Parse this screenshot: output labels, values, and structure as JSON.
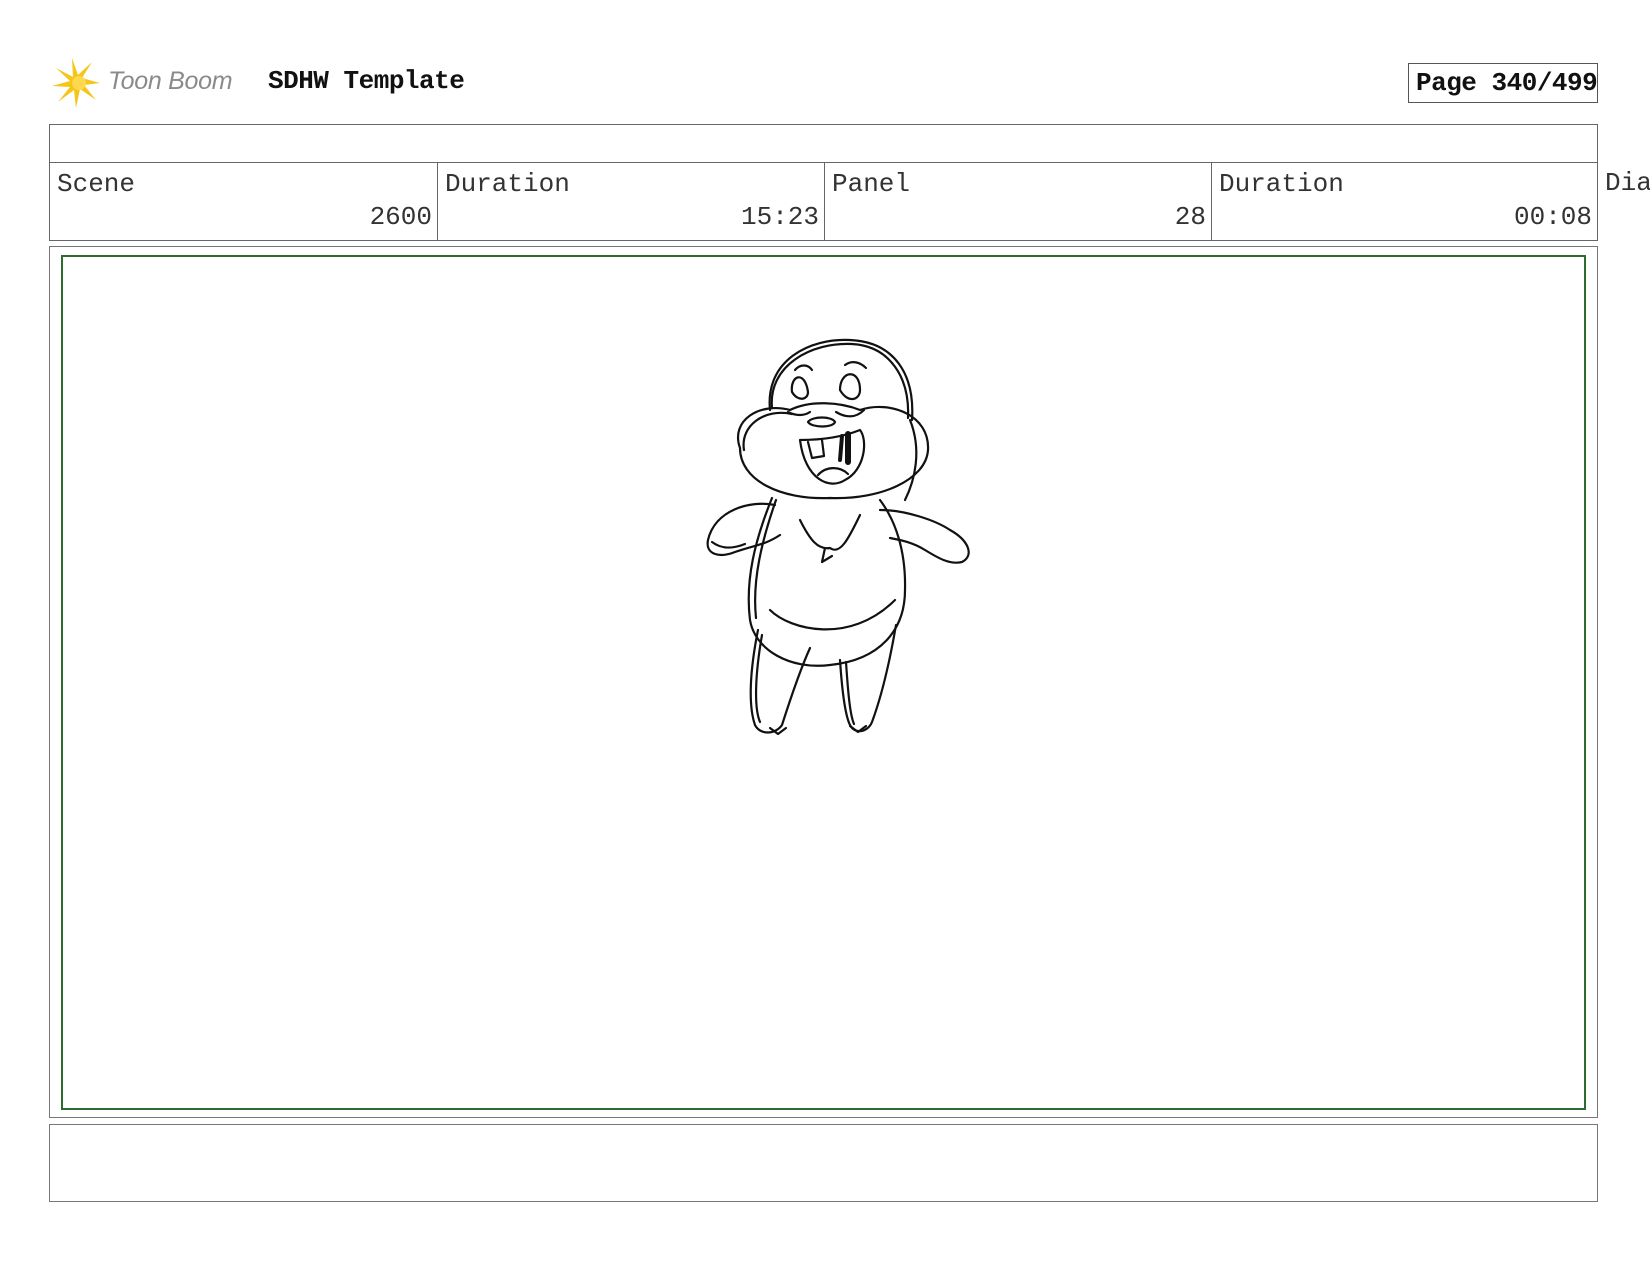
{
  "header": {
    "logo_text": "Toon Boom",
    "title": "SDHW Template",
    "page": "Page 340/499"
  },
  "info": {
    "scene_label": "Scene",
    "scene_value": "2600",
    "scene_duration_label": "Duration",
    "scene_duration_value": "15:23",
    "panel_label": "Panel",
    "panel_value": "28",
    "panel_duration_label": "Duration",
    "panel_duration_value": "00:08",
    "dialog_label": "Dia"
  },
  "colors": {
    "safe_frame": "#2f6b2f",
    "logo_burst": "#f5c518",
    "logo_text": "#8a8a8a"
  },
  "icons": {
    "logo": "starburst-icon"
  },
  "notes": ""
}
